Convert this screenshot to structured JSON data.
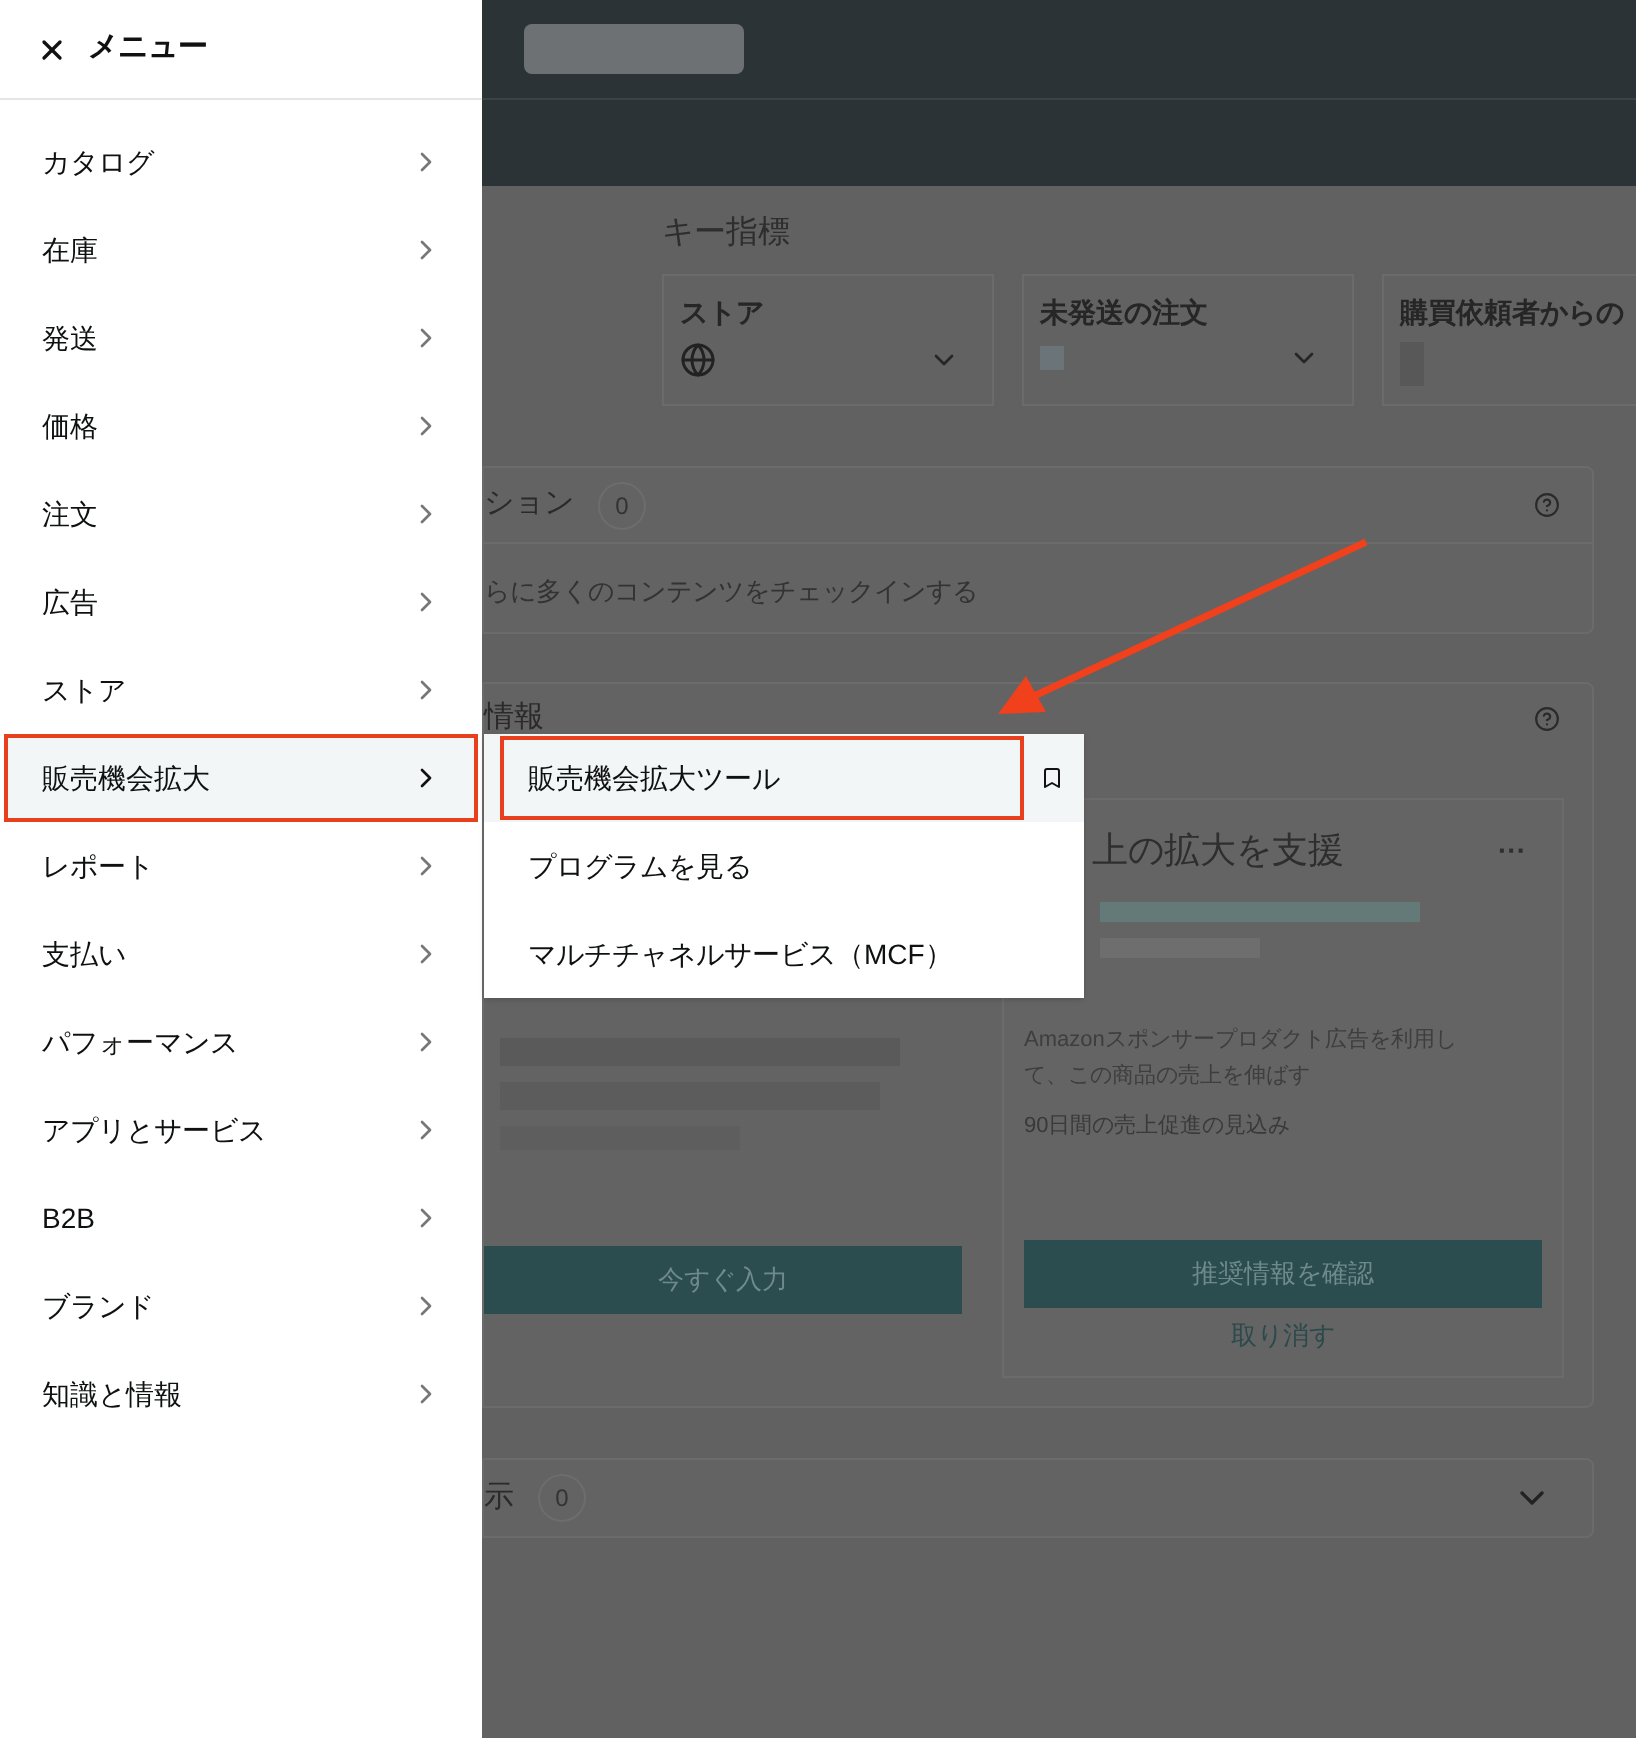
{
  "key_metrics": {
    "title": "キー指標",
    "cards": [
      {
        "title": "ストア",
        "kind": "store"
      },
      {
        "title": "未発送の注文",
        "kind": "dropdown"
      },
      {
        "title": "購買依頼者からの",
        "kind": "plain"
      }
    ]
  },
  "notifications_card": {
    "title": "ション",
    "count": "0",
    "body": "らに多くのコンテンツをチェックインする"
  },
  "info_card": {
    "title": "情報",
    "left_button": "今すぐ入力",
    "recommendation": {
      "title": "上の拡大を支援",
      "more": "···",
      "description": "Amazonスポンサープロダクト広告を利用して、この商品の売上を伸ばす",
      "estimate_label": "90日間の売上促進の見込み",
      "primary_button": "推奨情報を確認",
      "cancel_link": "取り消す"
    }
  },
  "collapsed_card": {
    "title": "示",
    "count": "0",
    "expanded": false
  },
  "menu": {
    "title": "メニュー",
    "items": [
      {
        "label": "カタログ",
        "selected": false
      },
      {
        "label": "在庫",
        "selected": false
      },
      {
        "label": "発送",
        "selected": false
      },
      {
        "label": "価格",
        "selected": false
      },
      {
        "label": "注文",
        "selected": false
      },
      {
        "label": "広告",
        "selected": false
      },
      {
        "label": "ストア",
        "selected": false
      },
      {
        "label": "販売機会拡大",
        "selected": true
      },
      {
        "label": "レポート",
        "selected": false
      },
      {
        "label": "支払い",
        "selected": false
      },
      {
        "label": "パフォーマンス",
        "selected": false
      },
      {
        "label": "アプリとサービス",
        "selected": false
      },
      {
        "label": "B2B",
        "selected": false
      },
      {
        "label": "ブランド",
        "selected": false
      },
      {
        "label": "知識と情報",
        "selected": false
      }
    ]
  },
  "submenu": {
    "items": [
      {
        "label": "販売機会拡大ツール",
        "selected": true
      },
      {
        "label": "プログラムを見る",
        "selected": false
      },
      {
        "label": "マルチチャネルサービス（MCF）",
        "selected": false
      }
    ]
  }
}
